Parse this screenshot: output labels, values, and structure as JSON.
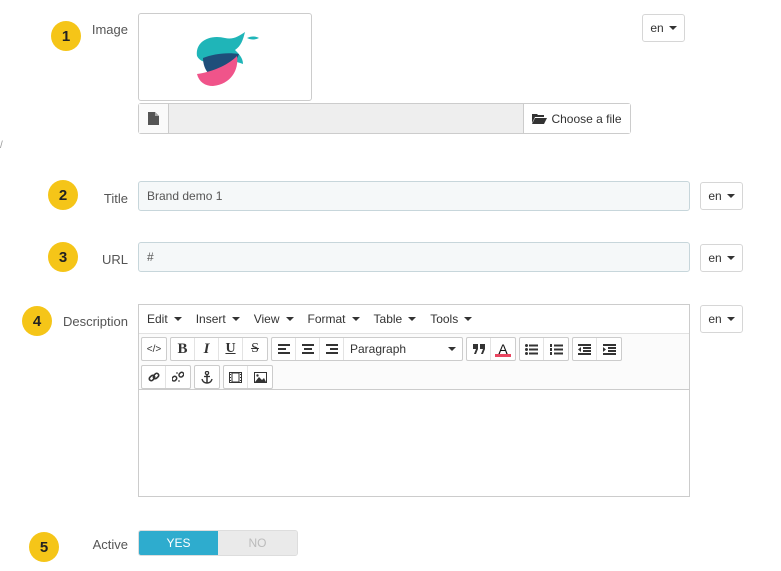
{
  "badges": [
    "1",
    "2",
    "3",
    "4",
    "5"
  ],
  "image_field": {
    "label": "Image",
    "lang": "en",
    "choose_file_label": "Choose a file"
  },
  "title_field": {
    "label": "Title",
    "value": "Brand demo 1",
    "lang": "en"
  },
  "url_field": {
    "label": "URL",
    "value": "#",
    "lang": "en"
  },
  "description_field": {
    "label": "Description",
    "lang": "en",
    "menus": [
      "Edit",
      "Insert",
      "View",
      "Format",
      "Table",
      "Tools"
    ],
    "format_select": "Paragraph",
    "toolbar_icons": [
      "source-code-icon",
      "bold-icon",
      "italic-icon",
      "underline-icon",
      "strikethrough-icon",
      "align-left-icon",
      "align-center-icon",
      "align-right-icon",
      "blockquote-icon",
      "text-color-icon",
      "bullet-list-icon",
      "numbered-list-icon",
      "outdent-icon",
      "indent-icon",
      "link-icon",
      "unlink-icon",
      "anchor-icon",
      "video-icon",
      "image-icon"
    ],
    "bold_glyph": "B",
    "italic_glyph": "I",
    "underline_glyph": "U",
    "strike_glyph": "S",
    "text_color_glyph": "A",
    "code_glyph": "</>"
  },
  "active_field": {
    "label": "Active",
    "yes_label": "YES",
    "no_label": "NO",
    "value": "YES"
  },
  "colors": {
    "badge": "#f5c518",
    "toggle_active": "#2eacce",
    "logo_teal": "#1fb5b8",
    "logo_navy": "#1e4e7a",
    "logo_pink": "#f0548a"
  }
}
